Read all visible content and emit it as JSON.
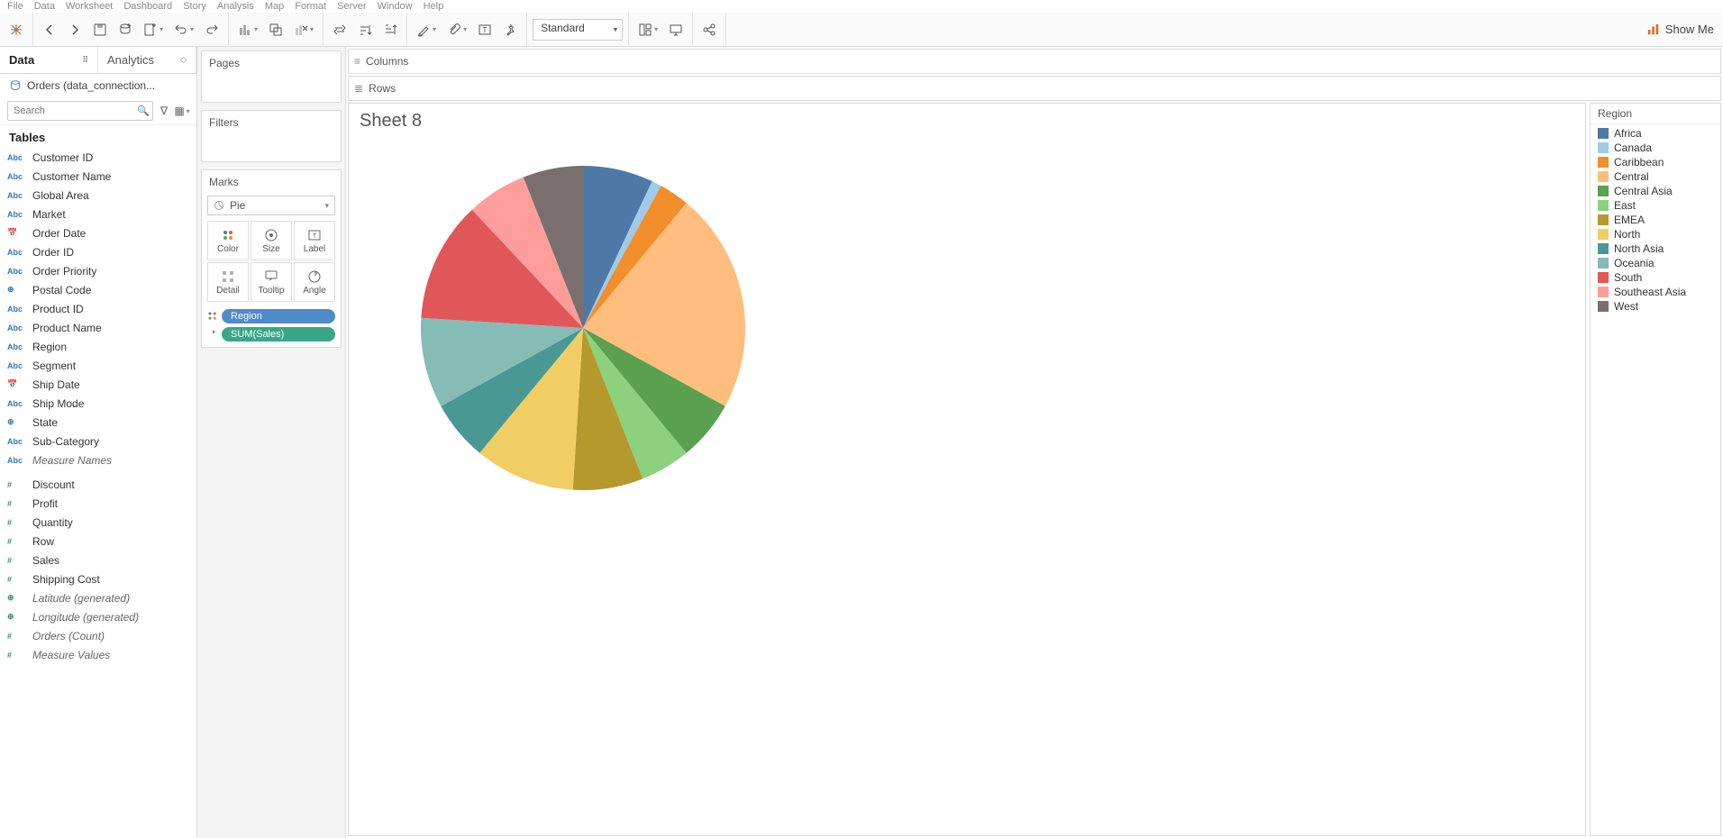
{
  "menu": [
    "File",
    "Data",
    "Worksheet",
    "Dashboard",
    "Story",
    "Analysis",
    "Map",
    "Format",
    "Server",
    "Window",
    "Help"
  ],
  "toolbar": {
    "fit": "Standard",
    "showme": "Show Me"
  },
  "side_tabs": {
    "data": "Data",
    "analytics": "Analytics"
  },
  "datasource": "Orders (data_connection...",
  "search_placeholder": "Search",
  "tables_header": "Tables",
  "fields_dim": [
    {
      "t": "Abc",
      "n": "Customer ID"
    },
    {
      "t": "Abc",
      "n": "Customer Name"
    },
    {
      "t": "Abc",
      "n": "Global Area"
    },
    {
      "t": "Abc",
      "n": "Market"
    },
    {
      "t": "date",
      "n": "Order Date"
    },
    {
      "t": "Abc",
      "n": "Order ID"
    },
    {
      "t": "Abc",
      "n": "Order Priority"
    },
    {
      "t": "geo",
      "n": "Postal Code"
    },
    {
      "t": "Abc",
      "n": "Product ID"
    },
    {
      "t": "Abc",
      "n": "Product Name"
    },
    {
      "t": "Abc",
      "n": "Region"
    },
    {
      "t": "Abc",
      "n": "Segment"
    },
    {
      "t": "date",
      "n": "Ship Date"
    },
    {
      "t": "Abc",
      "n": "Ship Mode"
    },
    {
      "t": "geo",
      "n": "State"
    },
    {
      "t": "Abc",
      "n": "Sub-Category"
    },
    {
      "t": "Abc",
      "n": "Measure Names",
      "italic": true
    }
  ],
  "fields_meas": [
    {
      "t": "num",
      "n": "Discount"
    },
    {
      "t": "num",
      "n": "Profit"
    },
    {
      "t": "num",
      "n": "Quantity"
    },
    {
      "t": "num",
      "n": "Row"
    },
    {
      "t": "num",
      "n": "Sales"
    },
    {
      "t": "num",
      "n": "Shipping Cost"
    },
    {
      "t": "geo",
      "n": "Latitude (generated)",
      "italic": true
    },
    {
      "t": "geo",
      "n": "Longitude (generated)",
      "italic": true
    },
    {
      "t": "num",
      "n": "Orders (Count)",
      "italic": true
    },
    {
      "t": "num",
      "n": "Measure Values",
      "italic": true
    }
  ],
  "shelves": {
    "pages": "Pages",
    "filters": "Filters",
    "marks": "Marks",
    "columns": "Columns",
    "rows": "Rows"
  },
  "mark_type": "Pie",
  "mark_cells": [
    "Color",
    "Size",
    "Label",
    "Detail",
    "Tooltip",
    "Angle"
  ],
  "pills": {
    "region": "Region",
    "sales": "SUM(Sales)"
  },
  "sheet_title": "Sheet 8",
  "legend_title": "Region",
  "chart_data": {
    "type": "pie",
    "title": "Sheet 8",
    "series": [
      {
        "name": "Africa",
        "value": 7,
        "color": "#4e79a7"
      },
      {
        "name": "Canada",
        "value": 1,
        "color": "#a0cbe8"
      },
      {
        "name": "Caribbean",
        "value": 3,
        "color": "#f28e2b"
      },
      {
        "name": "Central",
        "value": 22,
        "color": "#ffbe7d"
      },
      {
        "name": "Central Asia",
        "value": 6,
        "color": "#59a14f"
      },
      {
        "name": "East",
        "value": 5,
        "color": "#8cd17d"
      },
      {
        "name": "EMEA",
        "value": 7,
        "color": "#b6992d"
      },
      {
        "name": "North",
        "value": 10,
        "color": "#f1ce63"
      },
      {
        "name": "North Asia",
        "value": 6,
        "color": "#499894"
      },
      {
        "name": "Oceania",
        "value": 9,
        "color": "#86bcb6"
      },
      {
        "name": "South",
        "value": 12,
        "color": "#e15759"
      },
      {
        "name": "Southeast Asia",
        "value": 6,
        "color": "#ff9d9a"
      },
      {
        "name": "West",
        "value": 6,
        "color": "#79706e"
      }
    ]
  }
}
